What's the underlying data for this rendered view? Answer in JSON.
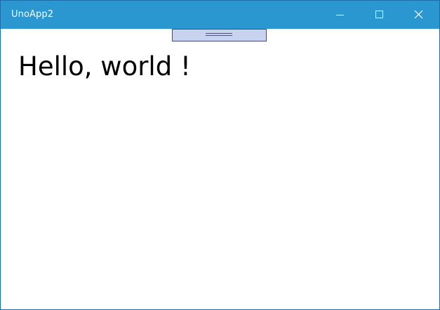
{
  "window": {
    "title": "UnoApp2",
    "titlebar_color": "#2b97d1",
    "border_color": "#1a6da8"
  },
  "caption_buttons": {
    "minimize_icon": "minimize-icon",
    "maximize_icon": "maximize-icon",
    "close_icon": "close-icon"
  },
  "drag_handle": {
    "icon": "drag-grip-icon",
    "fill_color": "#c9d3f0",
    "border_color": "#3e4a78"
  },
  "main": {
    "greeting": "Hello, world !"
  }
}
